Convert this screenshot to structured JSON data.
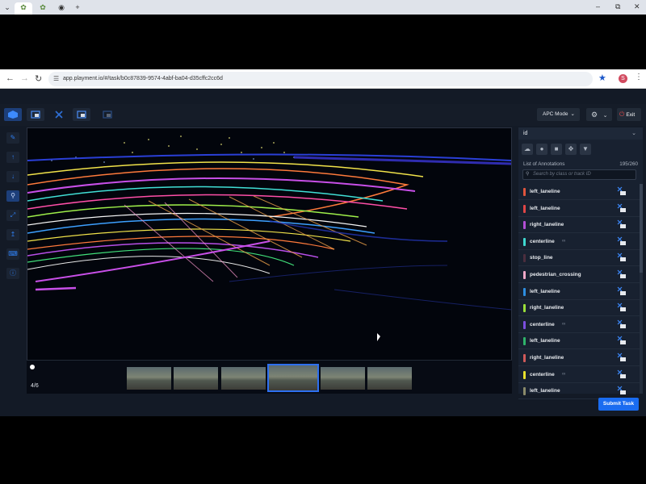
{
  "browser": {
    "new_tab_glyph": "+",
    "url": "app.playment.io/#/task/b0c87839-9574-4abf-ba04-d35cffc2cc6d",
    "profile_initial": "S"
  },
  "toolbar": {
    "mode_label": "APC Mode",
    "exit_label": "Exit"
  },
  "viewer": {
    "page_indicator": "4/6",
    "thumbnails": 6,
    "selected_thumbnail": 4
  },
  "panel": {
    "id_select": "id",
    "list_title": "List of Annotations",
    "list_count": "195/260",
    "search_placeholder": "Search by class or track ID",
    "annotations": [
      {
        "label": "left_laneline",
        "color": "#e0553d",
        "link": false
      },
      {
        "label": "left_laneline",
        "color": "#e04646",
        "link": false
      },
      {
        "label": "right_laneline",
        "color": "#b34fd6",
        "link": false
      },
      {
        "label": "centerline",
        "color": "#3fd9d1",
        "link": true
      },
      {
        "label": "stop_line",
        "color": "#4b2e3e",
        "link": false
      },
      {
        "label": "pedestrian_crossing",
        "color": "#f0a8c8",
        "link": false
      },
      {
        "label": "left_laneline",
        "color": "#2d8ee0",
        "link": false
      },
      {
        "label": "right_laneline",
        "color": "#9be03a",
        "link": false
      },
      {
        "label": "centerline",
        "color": "#7c4fe0",
        "link": true
      },
      {
        "label": "left_laneline",
        "color": "#2fb36a",
        "link": false
      },
      {
        "label": "right_laneline",
        "color": "#d05a5a",
        "link": false
      },
      {
        "label": "centerline",
        "color": "#e8e02c",
        "link": true
      },
      {
        "label": "left_laneline",
        "color": "#8a8a6a",
        "link": false
      }
    ]
  },
  "footer": {
    "submit_label": "Submit Task"
  },
  "colors": {
    "accent": "#1a6cf0",
    "panel_bg": "#182130",
    "canvas_bg": "#02050c",
    "exit_icon": "#e04a4a"
  }
}
